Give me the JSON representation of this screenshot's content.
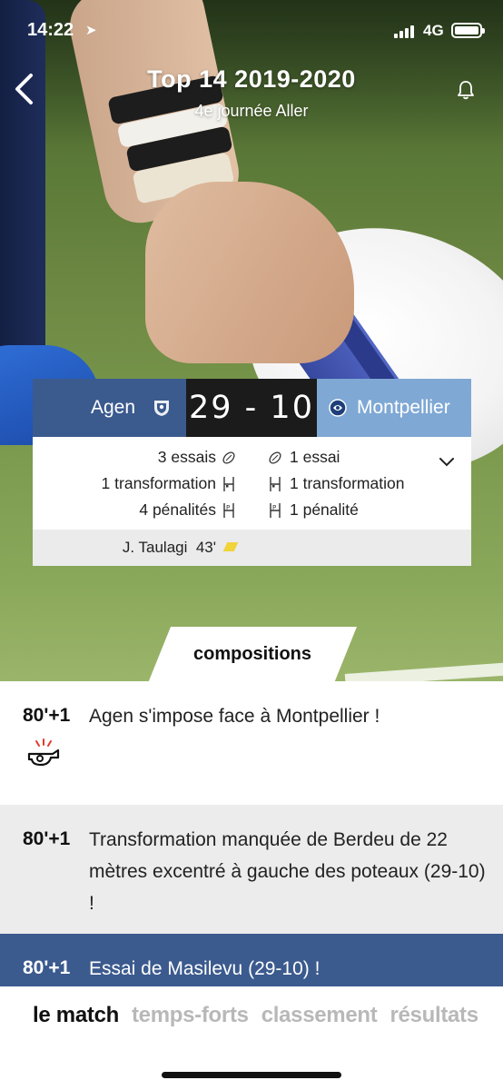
{
  "status_bar": {
    "time": "14:22",
    "network": "4G"
  },
  "header": {
    "title": "Top 14 2019-2020",
    "subtitle": "4e journée Aller"
  },
  "match": {
    "home_team": "Agen",
    "away_team": "Montpellier",
    "score": "29 - 10",
    "colors": {
      "home": "#3b5a8e",
      "away": "#7fa8d4",
      "score_bg": "#1b1b1b",
      "yellow_card": "#f1d33a"
    },
    "stats": [
      {
        "home": "3 essais",
        "away": "1 essai",
        "icon": "try-ball-icon"
      },
      {
        "home": "1 transformation",
        "away": "1 transformation",
        "icon": "goal-posts-icon"
      },
      {
        "home": "4 pénalités",
        "away": "1 pénalité",
        "icon": "penalty-posts-icon"
      }
    ],
    "cards": [
      {
        "player": "J. Taulagi",
        "minute": "43'",
        "type": "yellow"
      }
    ]
  },
  "compositions_label": "compositions",
  "feed": [
    {
      "minute": "80'+1",
      "text": "Agen s'impose face à Montpellier !",
      "icon": "whistle-icon"
    },
    {
      "minute": "80'+1",
      "text": "Transformation manquée de Berdeu de 22 mètres excentré à gauche des poteaux (29-10) !"
    },
    {
      "minute": "80'+1",
      "text": "Essai de Masilevu (29-10) !"
    }
  ],
  "bottom_tabs": [
    {
      "label": "le match",
      "active": true
    },
    {
      "label": "temps-forts",
      "active": false
    },
    {
      "label": "classement",
      "active": false
    },
    {
      "label": "résultats",
      "active": false
    }
  ]
}
